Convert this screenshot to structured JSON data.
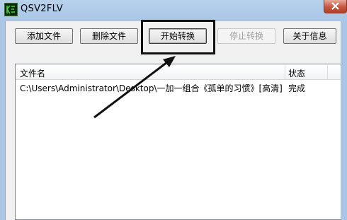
{
  "window": {
    "title": "QSV2FLV",
    "close_icon": "close-icon",
    "app_icon": "app-icon"
  },
  "toolbar": {
    "add_label": "添加文件",
    "delete_label": "删除文件",
    "start_label": "开始转换",
    "stop_label": "停止转换",
    "about_label": "关于信息"
  },
  "list": {
    "columns": [
      "文件名",
      "状态"
    ],
    "rows": [
      {
        "filename": "C:\\Users\\Administrator\\Desktop\\一加一组合《孤单的习惯》[高清]....",
        "status": "完成"
      }
    ]
  },
  "annotation": {
    "arrow_color": "#111111",
    "highlight_color": "#111111"
  }
}
